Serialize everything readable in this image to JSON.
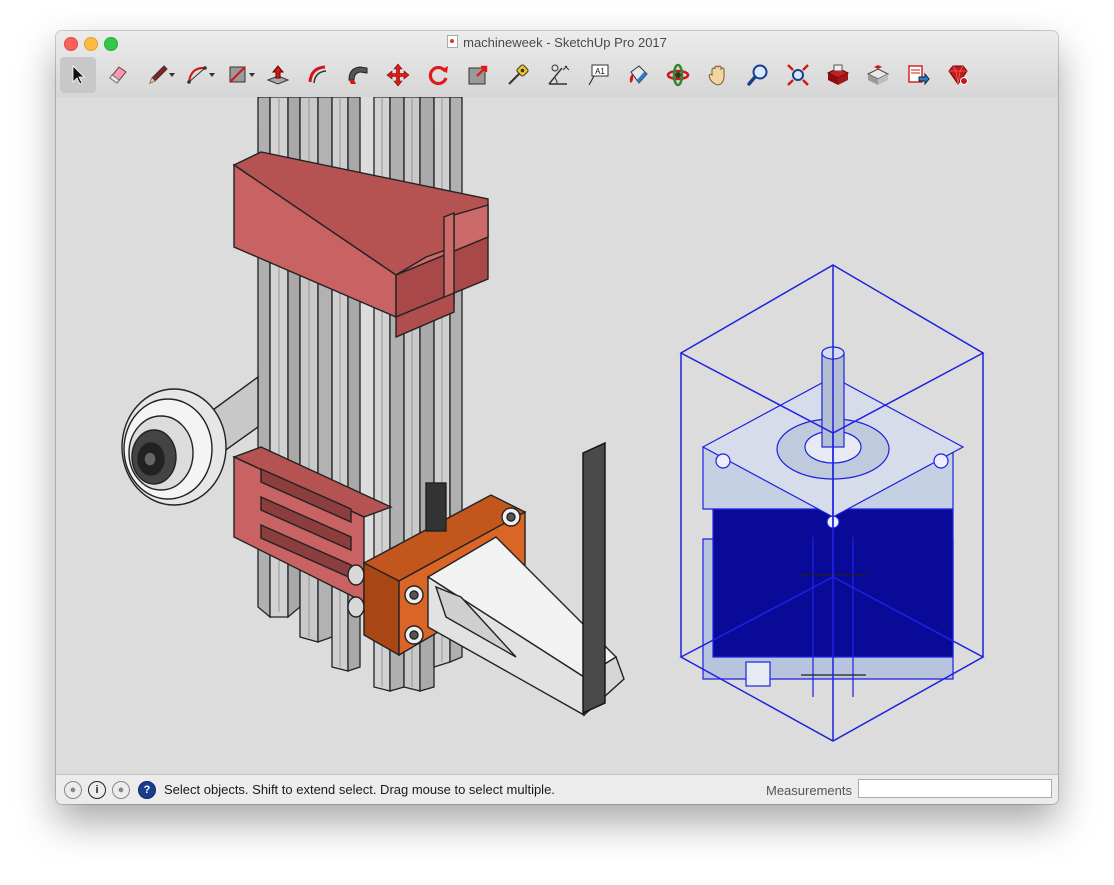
{
  "window": {
    "title": "machineweek - SketchUp Pro 2017"
  },
  "toolbar": {
    "tools": [
      {
        "name": "select-tool",
        "icon": "arrow-cursor-icon",
        "active": true
      },
      {
        "name": "eraser-tool",
        "icon": "eraser-icon"
      },
      {
        "name": "line-tool",
        "icon": "pencil-icon",
        "dropdown": true
      },
      {
        "name": "arc-tool",
        "icon": "arc-icon",
        "dropdown": true
      },
      {
        "name": "rectangle-tool",
        "icon": "rectangle-icon",
        "dropdown": true
      },
      {
        "name": "push-pull-tool",
        "icon": "push-pull-icon"
      },
      {
        "name": "offset-tool",
        "icon": "offset-icon"
      },
      {
        "name": "follow-me-tool",
        "icon": "follow-me-icon"
      },
      {
        "name": "move-tool",
        "icon": "move-arrows-icon"
      },
      {
        "name": "rotate-tool",
        "icon": "rotate-icon"
      },
      {
        "name": "scale-tool",
        "icon": "scale-icon"
      },
      {
        "name": "tape-measure-tool",
        "icon": "tape-measure-icon"
      },
      {
        "name": "protractor-tool",
        "icon": "protractor-icon"
      },
      {
        "name": "text-tool",
        "icon": "text-label-icon"
      },
      {
        "name": "paint-bucket-tool",
        "icon": "paint-bucket-icon"
      },
      {
        "name": "orbit-tool",
        "icon": "orbit-icon"
      },
      {
        "name": "pan-tool",
        "icon": "hand-icon"
      },
      {
        "name": "zoom-tool",
        "icon": "magnifier-icon"
      },
      {
        "name": "zoom-extents-tool",
        "icon": "zoom-extents-icon"
      },
      {
        "name": "warehouse-tool",
        "icon": "3d-warehouse-icon"
      },
      {
        "name": "extension-warehouse-tool",
        "icon": "extension-warehouse-icon"
      },
      {
        "name": "layout-tool",
        "icon": "send-to-layout-icon"
      },
      {
        "name": "ruby-console-tool",
        "icon": "ruby-gem-icon"
      }
    ],
    "text_tool_label": "A1"
  },
  "colors": {
    "bracket": "#c96262",
    "plate": "#d96626",
    "selection": "#1d22e0",
    "motor_body": "#0a0a99",
    "motor_cap": "#b8c4dd",
    "rail": "#c7c7c7"
  },
  "statusbar": {
    "message": "Select objects. Shift to extend select. Drag mouse to select multiple.",
    "measurements_label": "Measurements",
    "measurements_value": "",
    "info_glyph": "i",
    "help_glyph": "?"
  }
}
